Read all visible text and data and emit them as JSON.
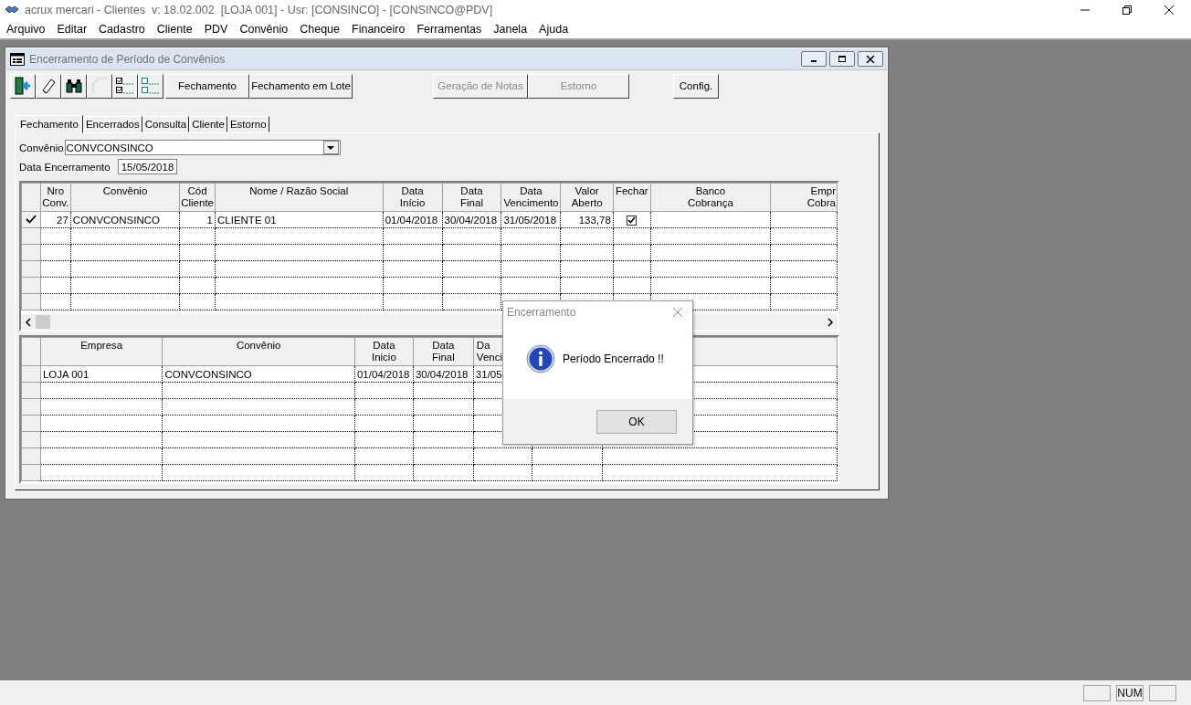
{
  "app": {
    "title": "acrux mercari - Clientes  v: 18.02.002  [LOJA 001] - Usr: [CONSINCO] - [CONSINCO@PDV]"
  },
  "menu": [
    "Arquivo",
    "Editar",
    "Cadastro",
    "Cliente",
    "PDV",
    "Convênio",
    "Cheque",
    "Financeiro",
    "Ferramentas",
    "Janela",
    "Ajuda"
  ],
  "window": {
    "title": "Encerramento de Período de Convênios",
    "icon_buttons": [
      {
        "kind": "exit",
        "disabled": false
      },
      {
        "kind": "eraser",
        "disabled": false
      },
      {
        "kind": "binoculars",
        "disabled": false
      },
      {
        "kind": "shape",
        "disabled": true
      },
      {
        "kind": "check-all",
        "disabled": false
      },
      {
        "kind": "uncheck-all",
        "disabled": false
      }
    ],
    "buttons": [
      {
        "label": "Fechamento",
        "disabled": false
      },
      {
        "label": "Fechamento em Lote",
        "disabled": false
      },
      {
        "label": "Geração de Notas",
        "disabled": true
      },
      {
        "label": "Estorno",
        "disabled": true
      },
      {
        "label": "Config.",
        "disabled": false
      }
    ],
    "tabs": [
      {
        "label": "Fechamento",
        "selected": true
      },
      {
        "label": "Encerrados",
        "selected": false
      },
      {
        "label": "Consulta",
        "selected": false
      },
      {
        "label": "Cliente",
        "selected": false
      },
      {
        "label": "Estorno",
        "selected": false
      }
    ],
    "convenio": {
      "label": "Convênio",
      "value": "CONVCONSINCO"
    },
    "data_encerramento": {
      "label": "Data Encerramento",
      "value": "15/05/2018"
    },
    "grid_convenios": {
      "columns": [
        {
          "header": "Nro\nConv.",
          "kind": "text"
        },
        {
          "header": "Convênio",
          "kind": "text"
        },
        {
          "header": "Cód\nCliente",
          "kind": "text"
        },
        {
          "header": "Nome / Razão Social",
          "kind": "text"
        },
        {
          "header": "Data\nInício",
          "kind": "text"
        },
        {
          "header": "Data\nFinal",
          "kind": "text"
        },
        {
          "header": "Data\nVencimento",
          "kind": "text"
        },
        {
          "header": "Valor\nAberto",
          "kind": "text"
        },
        {
          "header": "Fechar",
          "kind": "check"
        },
        {
          "header": "Banco\nCobrança",
          "kind": "text"
        },
        {
          "header": "Empr\nCobra",
          "kind": "text"
        }
      ],
      "rows": [
        {
          "current": true,
          "fechar": true,
          "cells": [
            "27",
            "CONVCONSINCO",
            "1",
            "CLIENTE 01",
            "01/04/2018",
            "30/04/2018",
            "31/05/2018",
            "133,78"
          ]
        }
      ]
    },
    "grid_empresas": {
      "columns": [
        {
          "header": "Empresa"
        },
        {
          "header": "Convênio"
        },
        {
          "header": "Data\nInicio"
        },
        {
          "header": "Data\nFinal"
        },
        {
          "header": "Da\nVenci"
        }
      ],
      "rows": [
        {
          "cells": [
            "LOJA 001",
            "CONVCONSINCO",
            "01/04/2018",
            "30/04/2018",
            "31/05"
          ]
        }
      ]
    }
  },
  "dialog": {
    "title": "Encerramento",
    "message": "Período Encerrado !!",
    "button": "OK"
  },
  "status_bar": {
    "num": "NUM"
  }
}
